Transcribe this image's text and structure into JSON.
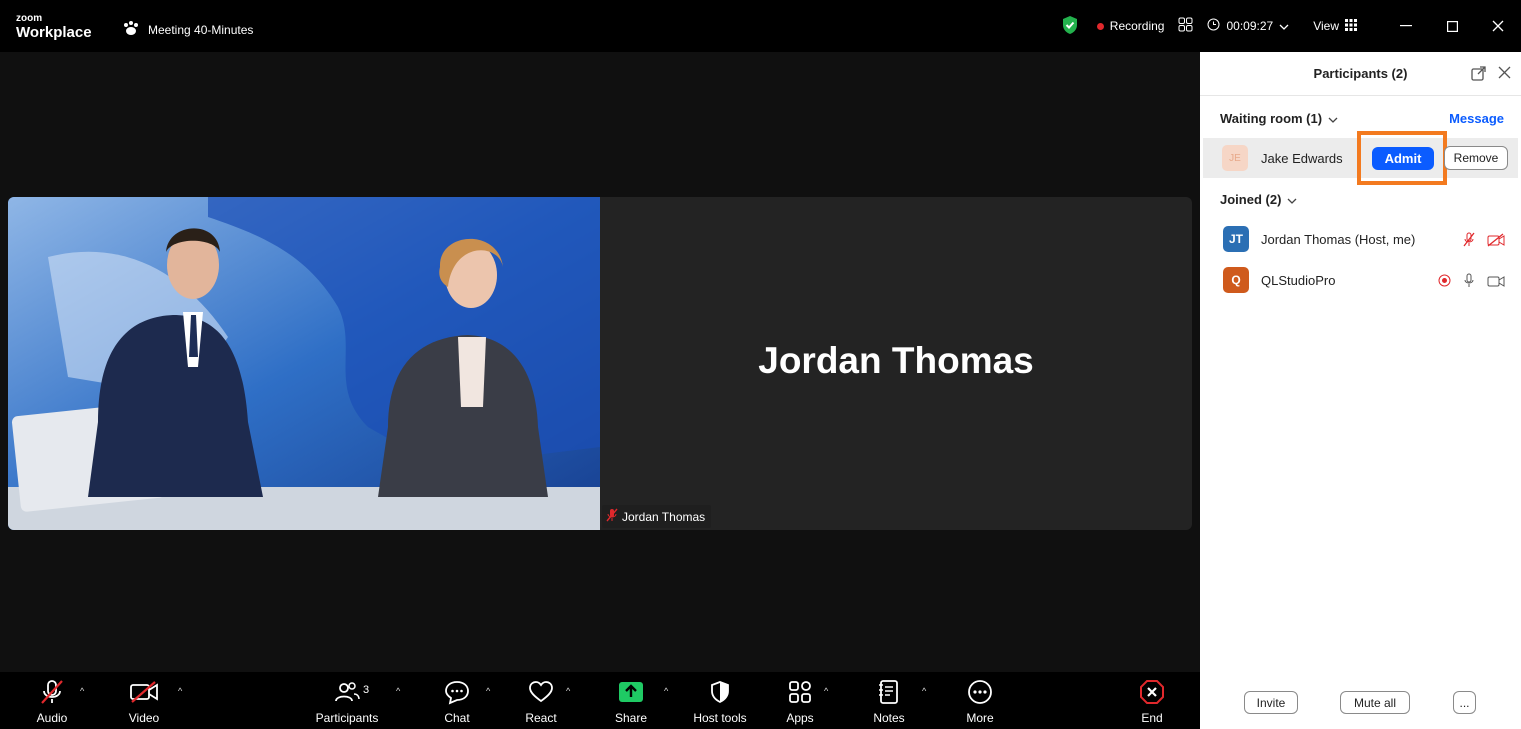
{
  "app": {
    "brand_small": "zoom",
    "brand_large": "Workplace"
  },
  "meeting": {
    "title": "Meeting 40-Minutes"
  },
  "titlebar": {
    "recording": "Recording",
    "timer": "00:09:27",
    "view": "View"
  },
  "stage": {
    "big_name": "Jordan Thomas",
    "tile_label": "Jordan Thomas"
  },
  "panel": {
    "title": "Participants (2)",
    "waiting_header": "Waiting room (1)",
    "message_link": "Message",
    "waiting": [
      {
        "initials": "JE",
        "name": "Jake Edwards",
        "admit": "Admit",
        "remove": "Remove"
      }
    ],
    "joined_header": "Joined (2)",
    "joined": [
      {
        "initials": "JT",
        "name": "Jordan Thomas (Host, me)",
        "color": "#2b6fb4"
      },
      {
        "initials": "Q",
        "name": "QLStudioPro",
        "color": "#cf5a1c"
      }
    ],
    "footer": {
      "invite": "Invite",
      "mute_all": "Mute all",
      "more": "..."
    }
  },
  "toolbar": {
    "audio": "Audio",
    "video": "Video",
    "participants": "Participants",
    "participants_count": "3",
    "chat": "Chat",
    "react": "React",
    "share": "Share",
    "host_tools": "Host tools",
    "apps": "Apps",
    "notes": "Notes",
    "more": "More",
    "end": "End"
  },
  "colors": {
    "accent": "#0b5cff",
    "highlight": "#f37a1f",
    "end": "#e0282c",
    "share": "#1fca64",
    "shield": "#23b14d"
  }
}
